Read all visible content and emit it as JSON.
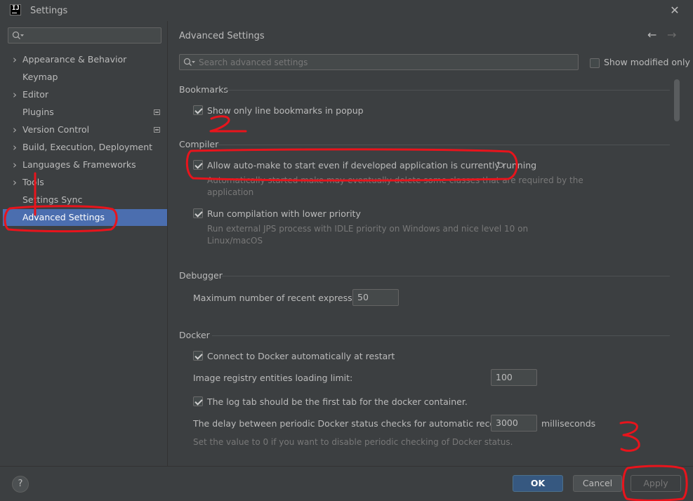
{
  "window": {
    "title": "Settings",
    "close_icon": "close-icon",
    "app_icon_text": "IJ"
  },
  "sidebar": {
    "search_placeholder": "",
    "items": [
      {
        "label": "Appearance & Behavior",
        "expandable": true,
        "badge": false
      },
      {
        "label": "Keymap",
        "expandable": false,
        "badge": false
      },
      {
        "label": "Editor",
        "expandable": true,
        "badge": false
      },
      {
        "label": "Plugins",
        "expandable": false,
        "badge": true
      },
      {
        "label": "Version Control",
        "expandable": true,
        "badge": true
      },
      {
        "label": "Build, Execution, Deployment",
        "expandable": true,
        "badge": false
      },
      {
        "label": "Languages & Frameworks",
        "expandable": true,
        "badge": false
      },
      {
        "label": "Tools",
        "expandable": true,
        "badge": false
      },
      {
        "label": "Settings Sync",
        "expandable": false,
        "badge": false
      },
      {
        "label": "Advanced Settings",
        "expandable": false,
        "badge": false,
        "selected": true
      }
    ]
  },
  "main": {
    "title": "Advanced Settings",
    "search_placeholder": "Search advanced settings",
    "show_modified_label": "Show modified only",
    "show_modified_checked": false,
    "sections": {
      "bookmarks": {
        "heading": "Bookmarks",
        "line_bookmarks_label": "Show only line bookmarks in popup",
        "line_bookmarks_checked": true
      },
      "compiler": {
        "heading": "Compiler",
        "auto_make_label": "Allow auto-make to start even if developed application is currently running",
        "auto_make_checked": true,
        "auto_make_desc_1": "Automatically started make may eventually delete some classes that are required by the",
        "auto_make_desc_2": "application",
        "low_priority_label": "Run compilation with lower priority",
        "low_priority_checked": true,
        "low_priority_desc_1": "Run external JPS process with IDLE priority on Windows and nice level 10 on",
        "low_priority_desc_2": "Linux/macOS"
      },
      "debugger": {
        "heading": "Debugger",
        "recent_expr_label": "Maximum number of recent expressions:",
        "recent_expr_value": "50"
      },
      "docker": {
        "heading": "Docker",
        "auto_connect_label": "Connect to Docker automatically at restart",
        "auto_connect_checked": true,
        "registry_limit_label": "Image registry entities loading limit:",
        "registry_limit_value": "100",
        "log_tab_label": "The log tab should be the first tab for the docker container.",
        "log_tab_checked": true,
        "delay_label": "The delay between periodic Docker status checks for automatic reconnection:",
        "delay_value": "3000",
        "delay_unit": "milliseconds",
        "delay_desc": "Set the value to 0 if you want to disable periodic checking of Docker status."
      }
    }
  },
  "footer": {
    "help_label": "?",
    "ok_label": "OK",
    "cancel_label": "Cancel",
    "apply_label": "Apply"
  },
  "annotations": {
    "color": "#e8141c",
    "marks": [
      "1",
      "2",
      "3"
    ]
  },
  "colors": {
    "background": "#3c3f41",
    "selected": "#4b6eaf",
    "ok_button": "#365880"
  }
}
